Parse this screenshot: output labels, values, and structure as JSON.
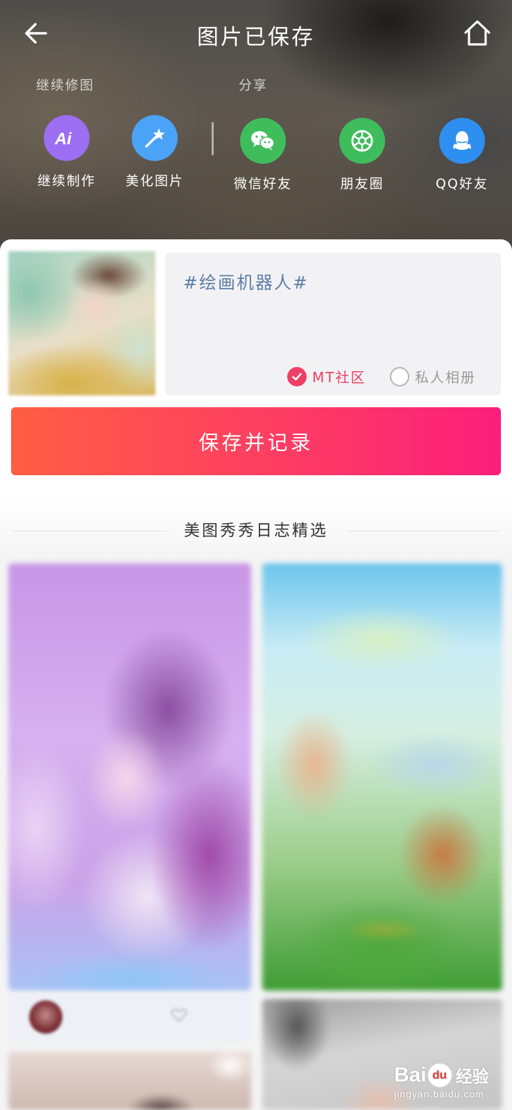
{
  "header": {
    "title": "图片已保存",
    "back_icon": "back-arrow-icon",
    "home_icon": "home-icon"
  },
  "sections": {
    "edit_label": "继续修图",
    "share_label": "分享"
  },
  "edit_actions": [
    {
      "label": "继续制作",
      "icon": "ai-icon",
      "color": "#9b6ef2"
    },
    {
      "label": "美化图片",
      "icon": "magic-wand-icon",
      "color": "#4aa3f7"
    }
  ],
  "share_actions": [
    {
      "label": "微信好友",
      "icon": "wechat-icon",
      "color": "#3fbd5c"
    },
    {
      "label": "朋友圈",
      "icon": "moments-icon",
      "color": "#3fbd5c"
    },
    {
      "label": "QQ好友",
      "icon": "qq-icon",
      "color": "#2f8ff0"
    }
  ],
  "post_form": {
    "caption": "#绘画机器人#",
    "option_community": "MT社区",
    "option_community_selected": true,
    "option_private": "私人相册",
    "option_private_selected": false,
    "accent_color": "#ee3f65"
  },
  "save_button": {
    "label": "保存并记录"
  },
  "feed": {
    "heading": "美图秀秀日志精选"
  },
  "watermark": {
    "brand_left": "Bai",
    "brand_du": "du",
    "brand_cn": "经验",
    "site": "jingyan.baidu.com"
  }
}
